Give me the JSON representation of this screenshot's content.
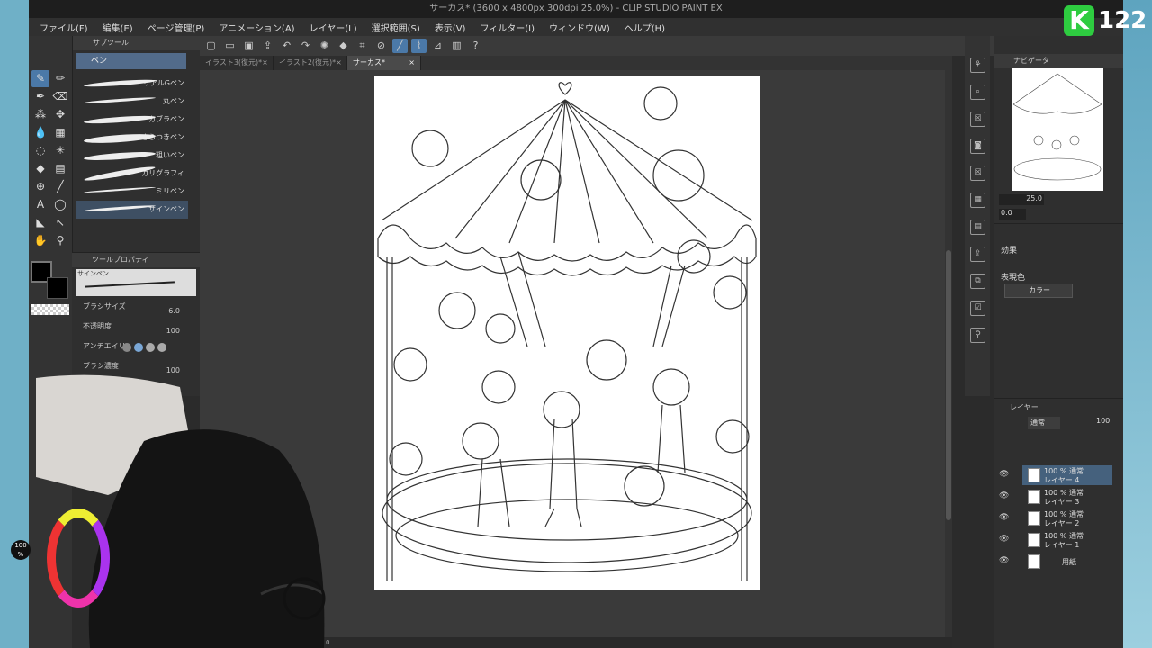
{
  "window": {
    "title": "サーカス* (3600 x 4800px 300dpi 25.0%)  - CLIP STUDIO PAINT EX"
  },
  "menu": [
    "ファイル(F)",
    "編集(E)",
    "ページ管理(P)",
    "アニメーション(A)",
    "レイヤー(L)",
    "選択範囲(S)",
    "表示(V)",
    "フィルター(I)",
    "ウィンドウ(W)",
    "ヘルプ(H)"
  ],
  "tabs": [
    {
      "label": "イラスト3(復元)*",
      "close": "×"
    },
    {
      "label": "イラスト2(復元)*",
      "close": "×"
    },
    {
      "label": "サーカス*",
      "close": "×"
    }
  ],
  "subtool": {
    "header": "サブツール",
    "selected": "ペン",
    "brushes": [
      "リアルGペン",
      "丸ペン",
      "カブラペン",
      "さらつきペン",
      "粗いペン",
      "カリグラフィ",
      "ミリペン",
      "サインペン"
    ]
  },
  "tool_property": {
    "header": "ツールプロパティ",
    "preview_label": "サインペン",
    "brush_size_label": "ブラシサイズ",
    "brush_size_value": "6.0",
    "opacity_label": "不透明度",
    "opacity_value": "100",
    "antialias_label": "アンチエイリ",
    "density_label": "ブラシ濃度",
    "density_value": "100"
  },
  "color": {
    "opacity_value": "100",
    "opacity_unit": "%",
    "main": "#000000",
    "sub": "#000000"
  },
  "navigator": {
    "header": "ナビゲータ",
    "zoom": "25.0",
    "rotate": "0.0"
  },
  "effect": {
    "header": "効果",
    "expression_label": "表現色",
    "expression_value": "カラー"
  },
  "layers": {
    "header": "レイヤー",
    "blend_mode": "通常",
    "opacity": "100",
    "items": [
      {
        "mode": "100 % 通常",
        "name": "レイヤー 4",
        "selected": true
      },
      {
        "mode": "100 % 通常",
        "name": "レイヤー 3",
        "selected": false
      },
      {
        "mode": "100 % 通常",
        "name": "レイヤー 2",
        "selected": false
      },
      {
        "mode": "100 % 通常",
        "name": "レイヤー 1",
        "selected": false
      },
      {
        "mode": "",
        "name": "用紙",
        "selected": false
      }
    ]
  },
  "badge": {
    "letter": "K",
    "number": "122"
  },
  "status": {
    "zoom": "0"
  },
  "colors": {
    "accent": "#4b79a8",
    "badge_green": "#2ecc40"
  }
}
